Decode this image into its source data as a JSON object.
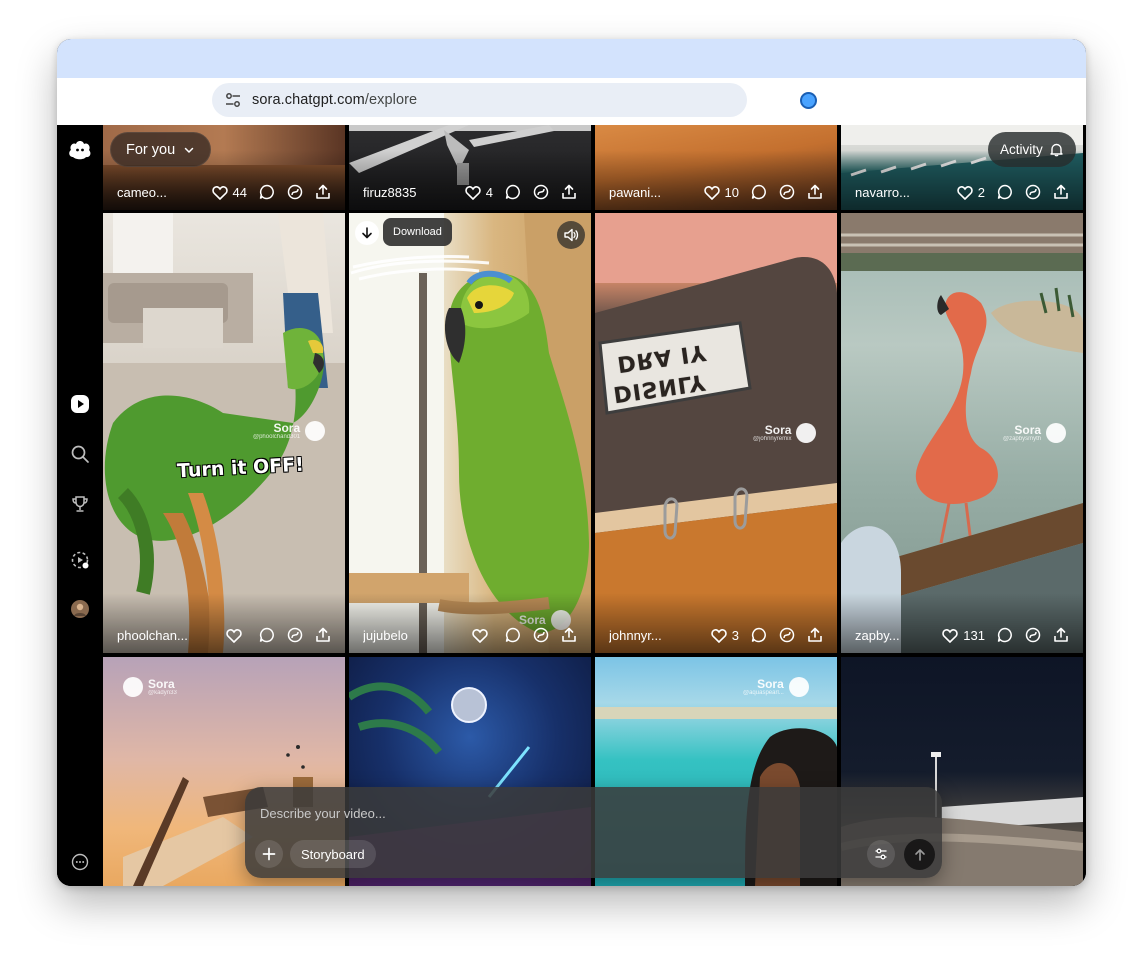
{
  "browser": {
    "url_host": "sora.chatgpt.com",
    "url_path": "/explore"
  },
  "header": {
    "feed_selector_label": "For you",
    "activity_label": "Activity"
  },
  "sidebar": {
    "items": [
      {
        "name": "logo",
        "icon": "sora-cloud-icon"
      },
      {
        "name": "explore",
        "icon": "play-icon"
      },
      {
        "name": "search",
        "icon": "search-icon"
      },
      {
        "name": "leaderboard",
        "icon": "trophy-icon"
      },
      {
        "name": "drafts",
        "icon": "sparkle-loader-icon"
      },
      {
        "name": "profile",
        "icon": "avatar"
      },
      {
        "name": "more",
        "icon": "more-icon"
      }
    ]
  },
  "tiles": [
    {
      "user": "cameo...",
      "likes": "44"
    },
    {
      "user": "firuz8835",
      "likes": "4"
    },
    {
      "user": "pawani...",
      "likes": "10"
    },
    {
      "user": "navarro...",
      "likes": "2"
    },
    {
      "user": "phoolchan...",
      "likes": "",
      "watermark_handle": "@phoolchand301",
      "caption": "Turn it OFF!"
    },
    {
      "user": "jujubelo",
      "likes": "",
      "download_label": "Download"
    },
    {
      "user": "johnnyr...",
      "likes": "3",
      "watermark_handle": "@johnnyremix",
      "notebook_text_line1": "DISNLY",
      "notebook_text_line2": "DRA IY"
    },
    {
      "user": "zapby...",
      "likes": "131",
      "watermark_handle": "@zapbysmyth"
    },
    {
      "watermark_handle": "@kadyn33"
    },
    {},
    {
      "watermark_handle": "@aquaspearl..."
    },
    {}
  ],
  "watermark_brand": "Sora",
  "composer": {
    "placeholder": "Describe your video...",
    "storyboard_label": "Storyboard"
  },
  "colors": {
    "tabstrip": "#d3e3fd",
    "omnibox": "#e9eef6",
    "page_bg": "#000000"
  }
}
